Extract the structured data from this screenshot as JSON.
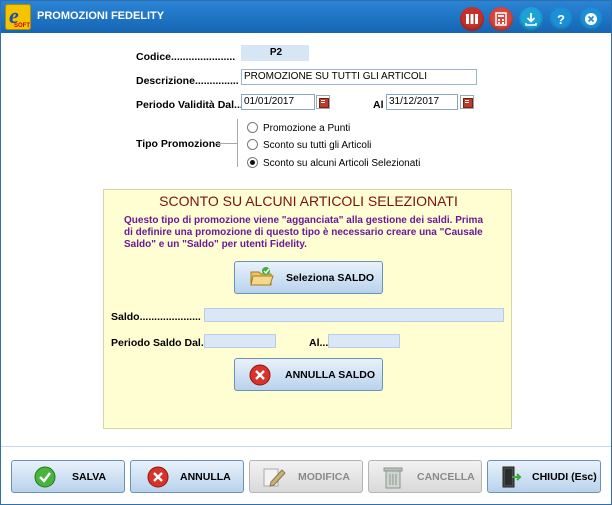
{
  "window": {
    "title": "PROMOZIONI FEDELITY",
    "app_icon": "e-app-icon"
  },
  "titlebar_buttons": [
    {
      "name": "books-icon",
      "color": "#c8312a"
    },
    {
      "name": "calculator-icon",
      "color": "#d8463c"
    },
    {
      "name": "download-icon",
      "color": "#1da1d8"
    },
    {
      "name": "help-icon",
      "color": "#1d8fd8"
    },
    {
      "name": "close-icon",
      "color": "#1d8fd8"
    }
  ],
  "form": {
    "codice_label": "Codice......................",
    "codice_value": "P2",
    "descrizione_label": "Descrizione...............",
    "descrizione_value": "PROMOZIONE SU TUTTI GLI ARTICOLI",
    "periodo_label": "Periodo Validità Dal...",
    "dal_value": "01/01/2017",
    "al_label": "Al",
    "al_value": "31/12/2017",
    "tipo_label": "Tipo Promozione",
    "tipo_options": [
      {
        "label": "Promozione a Punti",
        "selected": false
      },
      {
        "label": "Sconto su tutti gli Articoli",
        "selected": false
      },
      {
        "label": "Sconto su alcuni Articoli Selezionati",
        "selected": true
      }
    ]
  },
  "panel": {
    "title": "SCONTO SU ALCUNI ARTICOLI SELEZIONATI",
    "description": "Questo tipo di promozione viene \"agganciata\" alla gestione dei saldi. Prima di definire una promozione di questo tipo è necessario creare una \"Causale Saldo\" e un \"Saldo\" per utenti Fidelity.",
    "seleziona_label": "Seleziona SALDO",
    "saldo_label": "Saldo.....................",
    "periodo_saldo_label": "Periodo Saldo Dal...",
    "al_label": "Al...",
    "annulla_saldo_label": "ANNULLA SALDO"
  },
  "buttons": {
    "salva": "SALVA",
    "annulla": "ANNULLA",
    "modifica": "MODIFICA",
    "cancella": "CANCELLA",
    "chiudi": "CHIUDI (Esc)"
  }
}
